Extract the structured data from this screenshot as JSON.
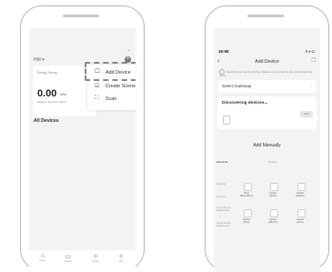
{
  "left_screen": {
    "home_name": "HM ▾",
    "energy_card": {
      "title": "Energy Saving",
      "value": "0.00",
      "unit": "kWh",
      "subtitle": "Usage in the Last 7 Days"
    },
    "menu": {
      "items": [
        {
          "icon": "device-icon",
          "glyph": "🖵",
          "label": "Add Device"
        },
        {
          "icon": "scene-icon",
          "glyph": "☑",
          "label": "Create Scene"
        },
        {
          "icon": "scan-icon",
          "glyph": "⛶",
          "label": "Scan"
        }
      ]
    },
    "all_devices": "All Devices",
    "tabbar": [
      {
        "icon": "home-icon",
        "glyph": "⌂",
        "label": "Home"
      },
      {
        "icon": "device-icon",
        "glyph": "▭",
        "label": "Device"
      },
      {
        "icon": "smart-icon",
        "glyph": "✧",
        "label": "Smart"
      },
      {
        "icon": "me-icon",
        "glyph": "✧",
        "label": "Me"
      }
    ]
  },
  "right_screen": {
    "time": "19:58",
    "status_icons": "ⵏⵏ ▾ ⬭",
    "title": "Add Device",
    "scan_note": "Searching for nearby devices. Make sure your device has entered pairing mode.",
    "gateway_label": "Select Gateway",
    "discovering": "Discovering devices...",
    "add_button": "Add",
    "add_manually": "Add Manually",
    "tabs": [
      "Electrical",
      "Socket"
    ],
    "categories": [
      "Lighting",
      "Sensors",
      "Large Home Appliances",
      "Small Home Appliances"
    ],
    "sockets_row1": [
      "Plug\n(BLE+Wi-Fi)",
      "Socket\n(Wi-Fi)",
      "Socket\n(Zigbee)"
    ],
    "sockets_row2": [
      "Socket\n(BLE)",
      "Socket\n(NB-IoT)",
      "Socket\n(other)"
    ]
  },
  "colors": {
    "accent": "#777777",
    "highlight_border": "#8a8a8a",
    "background": "#f3f3f3"
  }
}
